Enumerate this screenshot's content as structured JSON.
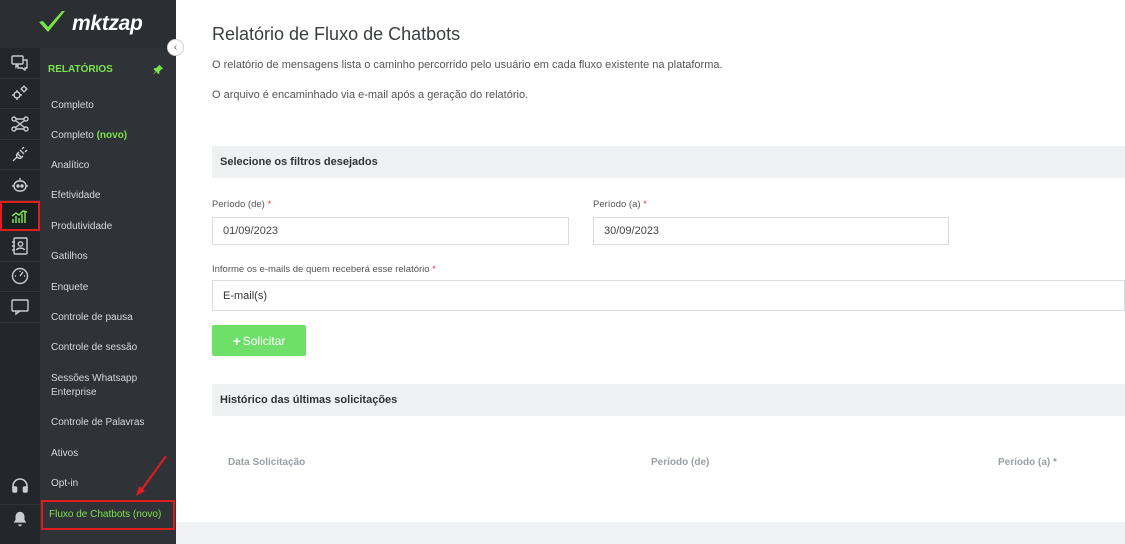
{
  "brand": {
    "name": "mktzap",
    "accent": "#7be34a"
  },
  "rail": {
    "items": [
      {
        "name": "chat-bubbles-icon"
      },
      {
        "name": "gears-icon"
      },
      {
        "name": "flow-network-icon"
      },
      {
        "name": "plug-icon"
      },
      {
        "name": "robot-icon"
      },
      {
        "name": "chart-icon",
        "active": true
      },
      {
        "name": "contact-book-icon"
      },
      {
        "name": "gauge-icon"
      },
      {
        "name": "message-square-icon"
      }
    ],
    "bottom": [
      {
        "name": "headset-icon"
      },
      {
        "name": "bell-icon"
      }
    ]
  },
  "sidebar": {
    "title": "RELATÓRIOS",
    "items": [
      {
        "label": "Completo"
      },
      {
        "label": "Completo",
        "badge": "(novo)"
      },
      {
        "label": "Analítico"
      },
      {
        "label": "Efetividade"
      },
      {
        "label": "Produtividade"
      },
      {
        "label": "Gatilhos"
      },
      {
        "label": "Enquete"
      },
      {
        "label": "Controle de pausa"
      },
      {
        "label": "Controle de sessão"
      },
      {
        "label": "Sessões Whatsapp Enterprise"
      },
      {
        "label": "Controle de Palavras"
      },
      {
        "label": "Ativos"
      },
      {
        "label": "Opt-in"
      },
      {
        "label": "Fluxo de Chatbots (novo)",
        "active": true
      }
    ]
  },
  "main": {
    "title": "Relatório de Fluxo de Chatbots",
    "desc1": "O relatório de mensagens lista o caminho percorrido pelo usuário em cada fluxo existente na plataforma.",
    "desc2": "O arquivo é encaminhado via e-mail após a geração do relatório.",
    "filters_title": "Selecione os filtros desejados",
    "period_from_label": "Período (de)",
    "period_from_value": "01/09/2023",
    "period_to_label": "Período (a)",
    "period_to_value": "30/09/2023",
    "emails_label": "Informe os e-mails de quem receberá esse relatório",
    "emails_placeholder": "E-mail(s)",
    "required_mark": "*",
    "submit_label": "Solicitar",
    "history_title": "Histórico das últimas solicitações",
    "table_headers": [
      "Data Solicitação",
      "Período (de)",
      "Período (a) *"
    ]
  }
}
